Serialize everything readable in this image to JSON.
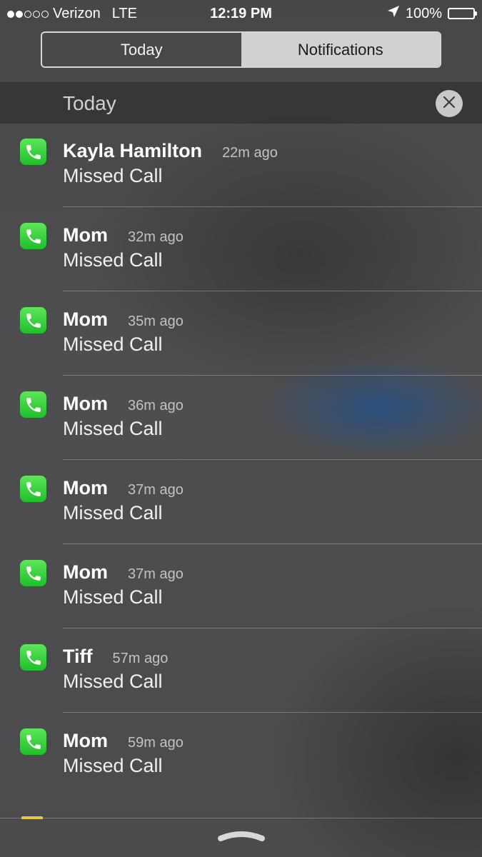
{
  "status_bar": {
    "carrier": "Verizon",
    "network": "LTE",
    "time": "12:19 PM",
    "battery": "100%",
    "signal_bars_filled": 2,
    "signal_bars_total": 5
  },
  "segmented_control": {
    "today_label": "Today",
    "notifications_label": "Notifications",
    "selected": "Notifications"
  },
  "section": {
    "title": "Today"
  },
  "notifications": [
    {
      "name": "Kayla Hamilton",
      "time": "22m ago",
      "message": "Missed Call"
    },
    {
      "name": "Mom",
      "time": "32m ago",
      "message": "Missed Call"
    },
    {
      "name": "Mom",
      "time": "35m ago",
      "message": "Missed Call"
    },
    {
      "name": "Mom",
      "time": "36m ago",
      "message": "Missed Call"
    },
    {
      "name": "Mom",
      "time": "37m ago",
      "message": "Missed Call"
    },
    {
      "name": "Mom",
      "time": "37m ago",
      "message": "Missed Call"
    },
    {
      "name": "Tiff",
      "time": "57m ago",
      "message": "Missed Call"
    },
    {
      "name": "Mom",
      "time": "59m ago",
      "message": "Missed Call"
    }
  ],
  "icons": {
    "app": "phone-icon",
    "clear": "close-icon",
    "location": "location-arrow-icon",
    "battery": "battery-icon",
    "handle": "grabber-handle-icon"
  },
  "colors": {
    "phone_green": "#2ecc40",
    "selected_segment": "#d1d1d3"
  }
}
